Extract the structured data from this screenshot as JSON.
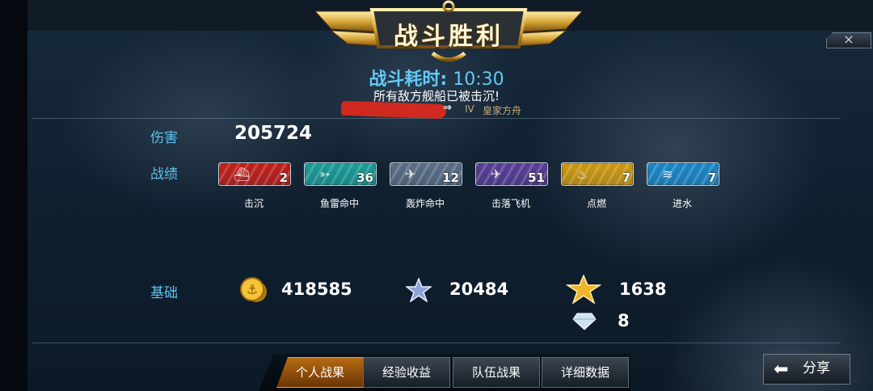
{
  "header": {
    "title": "战斗胜利",
    "close_icon": "×"
  },
  "battle": {
    "duration_label": "战斗耗时:",
    "duration_value": "10:30",
    "result_message": "所有敌方舰船已被击沉!",
    "ship_tier": "IV",
    "ship_name": "皇家方舟"
  },
  "damage": {
    "label": "伤害",
    "value": "205724"
  },
  "achievements": {
    "label": "战绩",
    "items": [
      {
        "name": "击沉",
        "count": "2",
        "color": "#c2201a",
        "icon": "sinking-ship-icon"
      },
      {
        "name": "鱼雷命中",
        "count": "36",
        "color": "#1b9e98",
        "icon": "torpedo-icon"
      },
      {
        "name": "轰炸命中",
        "count": "12",
        "color": "#5b6f86",
        "icon": "bomber-plane-icon"
      },
      {
        "name": "击落飞机",
        "count": "51",
        "color": "#5a3e98",
        "icon": "plane-shot-down-icon"
      },
      {
        "name": "点燃",
        "count": "7",
        "color": "#cf9a10",
        "icon": "fire-icon"
      },
      {
        "name": "进水",
        "count": "7",
        "color": "#1a87c7",
        "icon": "flooding-icon"
      }
    ]
  },
  "base": {
    "label": "基础",
    "credits": "418585",
    "experience": "20484",
    "captain_xp": "1638",
    "diamonds": "8"
  },
  "tabs": [
    {
      "label": "个人战果",
      "active": true
    },
    {
      "label": "经验收益",
      "active": false
    },
    {
      "label": "队伍战果",
      "active": false
    },
    {
      "label": "详细数据",
      "active": false
    }
  ],
  "share": {
    "label": "分享"
  }
}
